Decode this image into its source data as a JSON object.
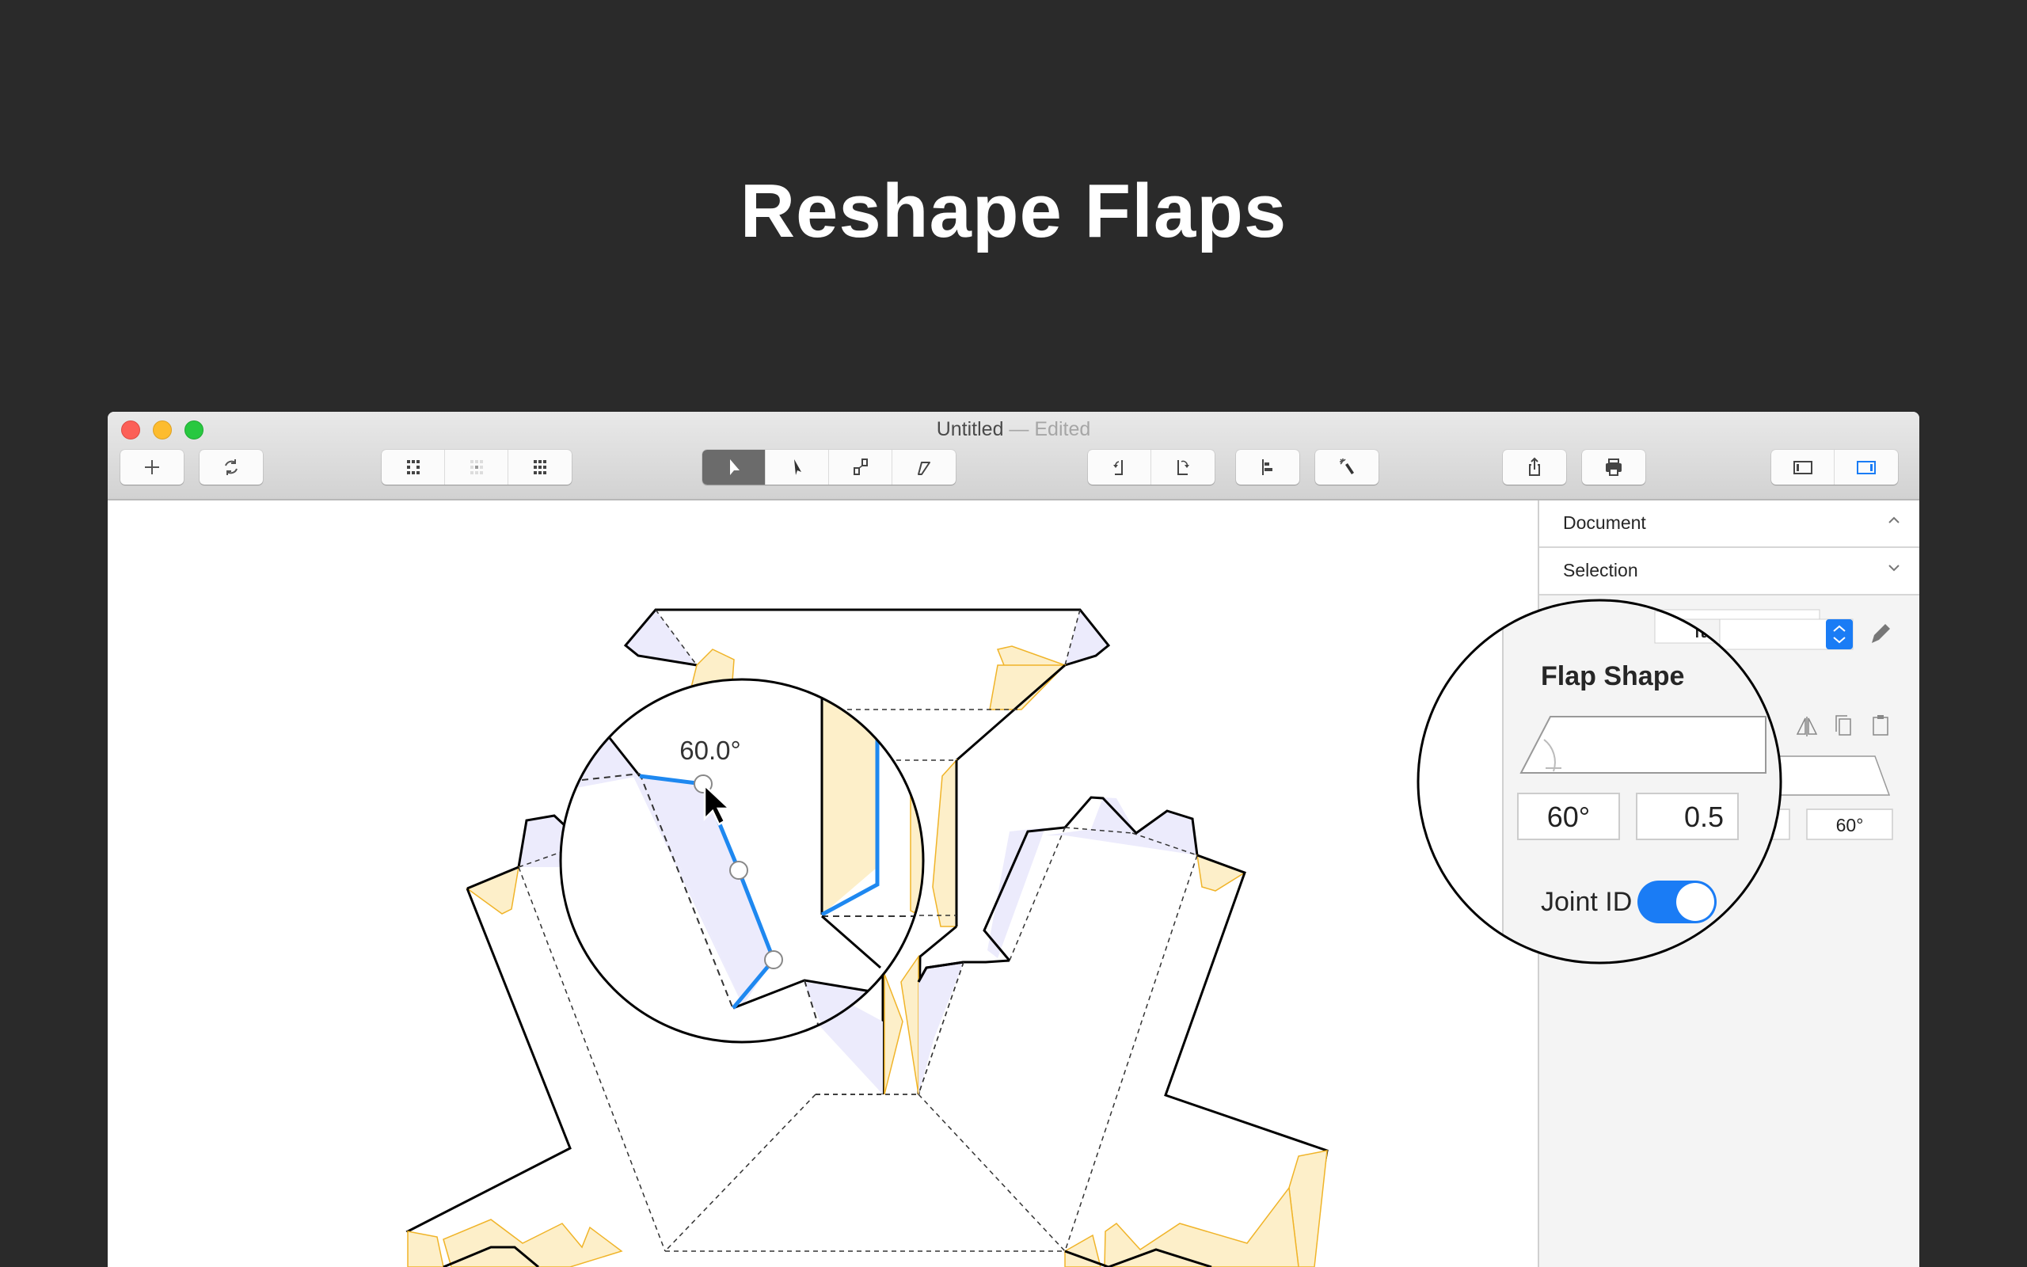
{
  "hero": {
    "title": "Reshape Flaps"
  },
  "window": {
    "title": "Untitled",
    "edited_suffix": " — Edited",
    "traffic_lights": [
      "close",
      "minimize",
      "zoom"
    ]
  },
  "toolbar": {
    "groups": [
      {
        "name": "add",
        "buttons": [
          {
            "icon": "plus-icon"
          }
        ]
      },
      {
        "name": "refresh",
        "buttons": [
          {
            "icon": "refresh-icon"
          }
        ]
      },
      {
        "name": "layout",
        "buttons": [
          {
            "icon": "grid-icon"
          },
          {
            "icon": "grid-faded-icon",
            "disabled": true
          },
          {
            "icon": "grid-dense-icon"
          }
        ]
      },
      {
        "name": "tools",
        "buttons": [
          {
            "icon": "select-arrow-icon",
            "active": true
          },
          {
            "icon": "direct-select-icon"
          },
          {
            "icon": "transform-icon"
          },
          {
            "icon": "flap-tool-icon"
          }
        ]
      },
      {
        "name": "fold",
        "buttons": [
          {
            "icon": "fold-left-icon"
          },
          {
            "icon": "fold-right-icon"
          }
        ]
      },
      {
        "name": "align",
        "buttons": [
          {
            "icon": "align-left-icon"
          }
        ]
      },
      {
        "name": "magic",
        "buttons": [
          {
            "icon": "magic-wand-icon"
          }
        ]
      },
      {
        "name": "share",
        "buttons": [
          {
            "icon": "share-icon"
          }
        ]
      },
      {
        "name": "print",
        "buttons": [
          {
            "icon": "print-icon"
          }
        ]
      },
      {
        "name": "panels",
        "buttons": [
          {
            "icon": "left-panel-icon"
          },
          {
            "icon": "right-panel-icon",
            "active": true
          }
        ]
      }
    ]
  },
  "inspector": {
    "sections": [
      {
        "label": "Document",
        "expanded": true
      },
      {
        "label": "Selection",
        "expanded": false
      }
    ],
    "preset_select": {
      "value": "Default",
      "visible_fragment": "lt"
    },
    "flap_shape": {
      "label": "Flap Shape",
      "left_angle": "60°",
      "height_ratio": "0.5",
      "right_angle": "60°"
    },
    "joint_id": {
      "label": "Joint ID",
      "enabled": true
    }
  },
  "canvas": {
    "angle_readout": "60.0°",
    "colors": {
      "flap_yellow_fill": "#fdefc9",
      "flap_yellow_stroke": "#f0b429",
      "flap_lavender_fill": "#ecebfc",
      "selection_blue": "#1e88f0",
      "accent_blue": "#1a7cf5"
    }
  }
}
